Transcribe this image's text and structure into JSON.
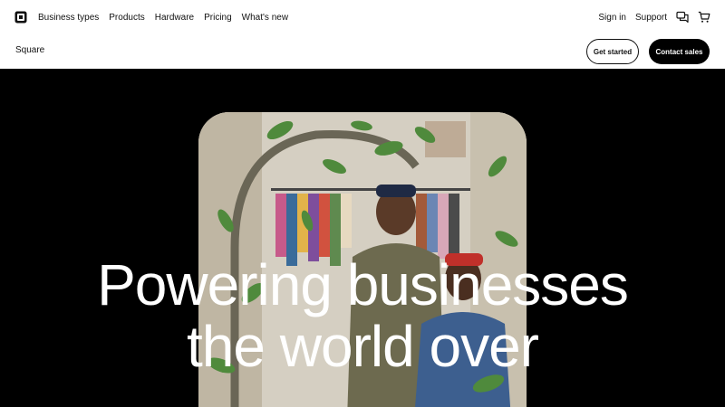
{
  "topnav": {
    "links": [
      "Business types",
      "Products",
      "Hardware",
      "Pricing",
      "What's new"
    ],
    "sign_in": "Sign in",
    "support": "Support",
    "icons": [
      "square-logo-icon",
      "chat-icon",
      "cart-icon"
    ]
  },
  "subnav": {
    "brand": "Square",
    "get_started": "Get started",
    "contact_sales": "Contact sales"
  },
  "hero": {
    "headline_line1": "Powering businesses",
    "headline_line2": "the world over"
  },
  "colors": {
    "nav_bg": "#ffffff",
    "hero_bg": "#000000",
    "text": "#111111"
  }
}
